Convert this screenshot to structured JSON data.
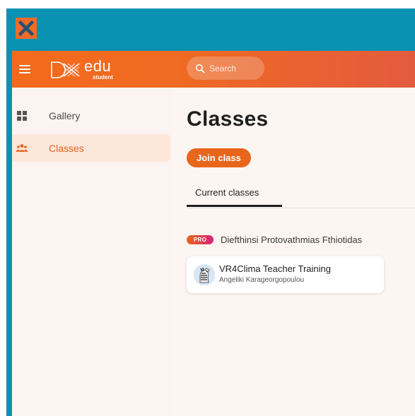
{
  "app": {
    "brand_name": "edu",
    "brand_sub": "student"
  },
  "search": {
    "placeholder": "Search"
  },
  "sidebar": {
    "items": [
      {
        "label": "Gallery",
        "icon": "grid-icon",
        "active": false
      },
      {
        "label": "Classes",
        "icon": "people-icon",
        "active": true
      }
    ]
  },
  "main": {
    "title": "Classes",
    "join_button": "Join class",
    "tabs": [
      {
        "label": "Current classes",
        "active": true
      }
    ],
    "organization": {
      "badge": "PRO",
      "name": "Diefthinsi Protovathmias Fthiotidas"
    },
    "classes": [
      {
        "title": "VR4Clima Teacher Training",
        "teacher": "Angeliki Karageorgopoulou"
      }
    ]
  },
  "colors": {
    "frame": "#0a92b2",
    "accent": "#e8651c",
    "topbar_start": "#f36a1c",
    "topbar_end": "#e35b3f",
    "active_nav_bg": "#fde7db",
    "background": "#fdf5f2"
  }
}
